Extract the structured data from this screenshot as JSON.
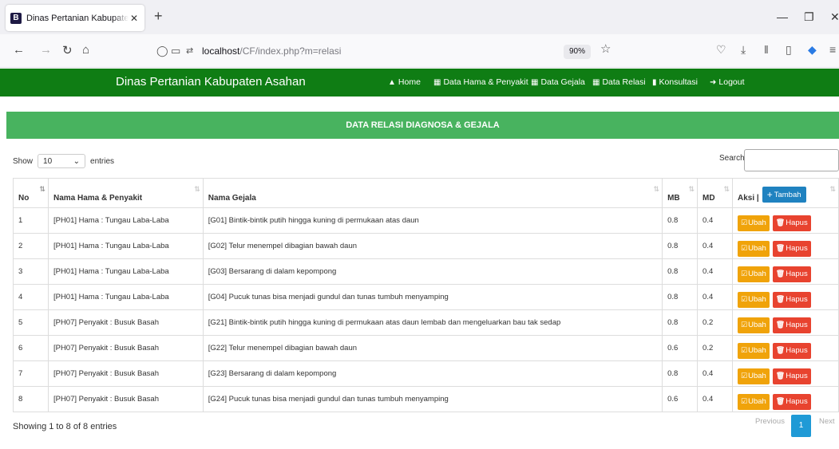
{
  "browser": {
    "tab_icon_letter": "B",
    "tab_title": "Dinas Pertanian Kabupaten Asahan",
    "url_host": "localhost",
    "url_path": "/CF/index.php?m=relasi",
    "zoom": "90%"
  },
  "site": {
    "brand": "Dinas Pertanian Kabupaten Asahan",
    "menu": [
      {
        "label": "Home",
        "icon": "home-icon"
      },
      {
        "label": "Data Hama & Penyakit",
        "icon": "table-icon"
      },
      {
        "label": "Data Gejala",
        "icon": "table-icon"
      },
      {
        "label": "Data Relasi",
        "icon": "table-icon"
      },
      {
        "label": "Konsultasi",
        "icon": "bar-chart-icon"
      },
      {
        "label": "Logout",
        "icon": "logout-icon"
      }
    ],
    "colors": {
      "navbar": "#0f7d14",
      "panel": "#48b35f",
      "ubah": "#f0a30a",
      "hapus": "#e8432f",
      "tambah": "#1f82c0"
    }
  },
  "panel": {
    "title": "DATA RELASI DIAGNOSA & GEJALA",
    "show_label": "Show",
    "entries_value": "10",
    "entries_label": "entries",
    "search_label": "Search:",
    "search_value": ""
  },
  "table": {
    "headers": {
      "no": "No",
      "penyakit": "Nama Hama & Penyakit",
      "gejala": "Nama Gejala",
      "mb": "MB",
      "md": "MD",
      "aksi": "Aksi |",
      "tambah": "Tambah"
    },
    "ubah_label": "Ubah",
    "hapus_label": "Hapus",
    "rows": [
      {
        "no": "1",
        "penyakit": "[PH01] Hama : Tungau Laba-Laba",
        "gejala": "[G01] Bintik-bintik putih hingga kuning di permukaan atas daun",
        "mb": "0.8",
        "md": "0.4"
      },
      {
        "no": "2",
        "penyakit": "[PH01] Hama : Tungau Laba-Laba",
        "gejala": "[G02] Telur menempel dibagian bawah daun",
        "mb": "0.8",
        "md": "0.4"
      },
      {
        "no": "3",
        "penyakit": "[PH01] Hama : Tungau Laba-Laba",
        "gejala": "[G03] Bersarang di dalam kepompong",
        "mb": "0.8",
        "md": "0.4"
      },
      {
        "no": "4",
        "penyakit": "[PH01] Hama : Tungau Laba-Laba",
        "gejala": "[G04] Pucuk tunas bisa menjadi gundul dan tunas tumbuh menyamping",
        "mb": "0.8",
        "md": "0.4"
      },
      {
        "no": "5",
        "penyakit": "[PH07] Penyakit : Busuk Basah",
        "gejala": "[G21] Bintik-bintik putih hingga kuning di permukaan atas daun lembab dan mengeluarkan bau tak sedap",
        "mb": "0.8",
        "md": "0.2"
      },
      {
        "no": "6",
        "penyakit": "[PH07] Penyakit : Busuk Basah",
        "gejala": "[G22] Telur menempel dibagian bawah daun",
        "mb": "0.6",
        "md": "0.2"
      },
      {
        "no": "7",
        "penyakit": "[PH07] Penyakit : Busuk Basah",
        "gejala": "[G23] Bersarang di dalam kepompong",
        "mb": "0.8",
        "md": "0.4"
      },
      {
        "no": "8",
        "penyakit": "[PH07] Penyakit : Busuk Basah",
        "gejala": "[G24] Pucuk tunas bisa menjadi gundul dan tunas tumbuh menyamping",
        "mb": "0.6",
        "md": "0.4"
      }
    ]
  },
  "footer": {
    "info": "Showing 1 to 8 of 8 entries",
    "previous": "Previous",
    "current_page": "1",
    "next": "Next"
  }
}
